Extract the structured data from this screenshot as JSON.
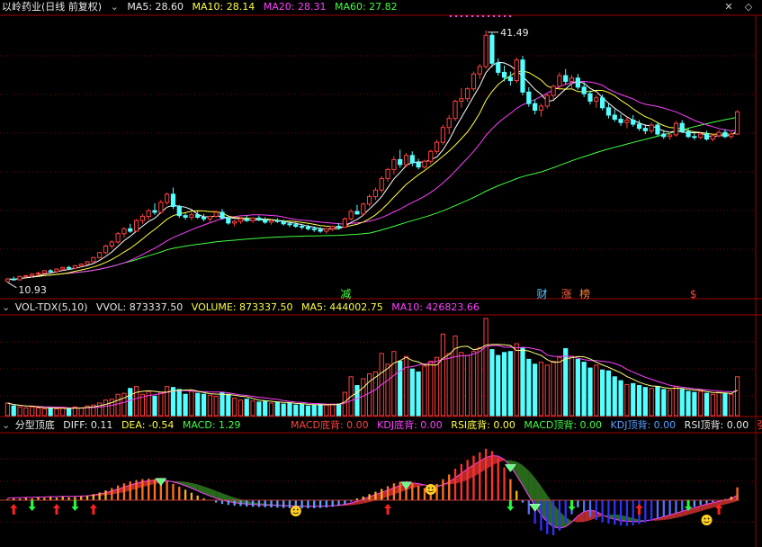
{
  "colors": {
    "bg": "#000000",
    "grid": "#7a0000",
    "up": "#ff4040",
    "down": "#54ffff",
    "ma5": "#ffffff",
    "ma10": "#ffff40",
    "ma20": "#ff40ff",
    "ma60": "#40ff40",
    "label_white": "#e8e8e8",
    "label_yellow": "#ffff40",
    "label_magenta": "#ff40ff",
    "label_green": "#40ff40",
    "label_red": "#ff4040"
  },
  "price_panel": {
    "stock_name": "以岭药业(日线 前复权)",
    "ma5_text": "MA5: 28.60",
    "ma10_text": "MA10: 28.14",
    "ma20_text": "MA20: 28.31",
    "ma60_text": "MA60: 27.82",
    "high_label": "41.49",
    "low_label": "10.93",
    "markers": [
      {
        "text": "减",
        "color": "#40ff40"
      },
      {
        "text": "财",
        "color": "#54c8ff"
      },
      {
        "text": "涨",
        "color": "#ff6040"
      },
      {
        "text": "榜",
        "color": "#ff8040"
      },
      {
        "text": "$",
        "color": "#ff4040"
      }
    ]
  },
  "volume_panel": {
    "indicator": "VOL-TDX(5,10)",
    "vvol_text": "VVOL: 873337.50",
    "volume_text": "VOLUME: 873337.50",
    "ma5_text": "MA5: 444002.75",
    "ma10_text": "MA10: 426823.66"
  },
  "macd_panel": {
    "indicator": "分型顶底",
    "diff_text": "DIFF: 0.11",
    "dea_text": "DEA: -0.54",
    "macd_text": "MACD: 1.29",
    "signals": [
      {
        "text": "MACD底背: 0.00",
        "color": "#ff4040"
      },
      {
        "text": "KDJ底背: 0.00",
        "color": "#ff40ff"
      },
      {
        "text": "RSI底背: 0.00",
        "color": "#ffff40"
      },
      {
        "text": "MACD顶背: 0.00",
        "color": "#40ff40"
      },
      {
        "text": "KDJ顶背: 0.00",
        "color": "#5aa0ff"
      },
      {
        "text": "RSI顶背: 0.00",
        "color": "#e8e8e8"
      },
      {
        "text": "强",
        "color": "#ff4040"
      }
    ]
  },
  "chart_data": {
    "type": "candlestick",
    "title": "以岭药业(日线 前复权)",
    "ylim": [
      10,
      43
    ],
    "candles": [
      [
        11.0,
        11.4,
        10.9,
        11.3
      ],
      [
        11.3,
        11.6,
        11.1,
        11.2
      ],
      [
        11.2,
        11.7,
        11.1,
        11.6
      ],
      [
        11.6,
        11.8,
        11.4,
        11.7
      ],
      [
        11.7,
        12.0,
        11.5,
        11.9
      ],
      [
        11.9,
        12.2,
        11.7,
        12.0
      ],
      [
        12.0,
        12.4,
        11.9,
        12.3
      ],
      [
        12.3,
        12.5,
        12.1,
        12.2
      ],
      [
        12.2,
        12.6,
        12.0,
        12.5
      ],
      [
        12.5,
        12.8,
        12.3,
        12.7
      ],
      [
        12.7,
        12.9,
        12.4,
        12.6
      ],
      [
        12.6,
        13.0,
        12.5,
        12.9
      ],
      [
        12.9,
        13.2,
        12.7,
        13.1
      ],
      [
        13.1,
        13.5,
        13.0,
        13.4
      ],
      [
        13.4,
        14.0,
        13.3,
        13.9
      ],
      [
        13.9,
        14.6,
        13.8,
        14.5
      ],
      [
        14.5,
        15.5,
        14.3,
        15.3
      ],
      [
        15.3,
        16.0,
        15.0,
        15.8
      ],
      [
        15.8,
        17.0,
        15.6,
        16.8
      ],
      [
        16.8,
        17.6,
        16.3,
        17.4
      ],
      [
        17.4,
        18.0,
        16.9,
        17.1
      ],
      [
        17.1,
        18.6,
        17.0,
        18.4
      ],
      [
        18.4,
        19.2,
        18.0,
        18.9
      ],
      [
        18.9,
        19.8,
        18.5,
        19.6
      ],
      [
        19.6,
        20.5,
        19.1,
        19.4
      ],
      [
        19.4,
        20.9,
        19.2,
        20.6
      ],
      [
        20.6,
        21.8,
        20.3,
        21.6
      ],
      [
        21.6,
        22.4,
        19.8,
        20.1
      ],
      [
        20.1,
        20.3,
        18.7,
        19.0
      ],
      [
        19.0,
        19.3,
        18.5,
        18.8
      ],
      [
        18.8,
        19.4,
        18.4,
        19.1
      ],
      [
        19.1,
        19.5,
        18.6,
        18.8
      ],
      [
        18.8,
        19.2,
        18.3,
        18.6
      ],
      [
        18.6,
        19.0,
        18.2,
        18.9
      ],
      [
        18.9,
        19.6,
        18.7,
        19.4
      ],
      [
        19.4,
        19.8,
        18.5,
        18.7
      ],
      [
        18.7,
        18.9,
        17.9,
        18.1
      ],
      [
        18.1,
        18.5,
        17.7,
        18.3
      ],
      [
        18.3,
        18.8,
        18.0,
        18.6
      ],
      [
        18.6,
        19.0,
        18.2,
        18.4
      ],
      [
        18.4,
        18.8,
        18.1,
        18.7
      ],
      [
        18.7,
        19.0,
        18.3,
        18.5
      ],
      [
        18.5,
        18.8,
        18.0,
        18.2
      ],
      [
        18.2,
        18.6,
        17.9,
        18.4
      ],
      [
        18.4,
        18.7,
        18.1,
        18.3
      ],
      [
        18.3,
        18.5,
        17.8,
        18.0
      ],
      [
        18.0,
        18.3,
        17.6,
        17.9
      ],
      [
        17.9,
        18.2,
        17.5,
        17.7
      ],
      [
        17.7,
        18.0,
        17.3,
        17.6
      ],
      [
        17.6,
        17.9,
        17.2,
        17.4
      ],
      [
        17.4,
        17.7,
        17.0,
        17.3
      ],
      [
        17.3,
        17.6,
        16.9,
        17.1
      ],
      [
        17.1,
        17.5,
        16.8,
        17.4
      ],
      [
        17.4,
        17.8,
        17.1,
        17.7
      ],
      [
        17.7,
        18.1,
        17.3,
        17.6
      ],
      [
        17.6,
        18.8,
        17.5,
        18.6
      ],
      [
        18.6,
        19.8,
        18.4,
        19.5
      ],
      [
        19.5,
        20.3,
        19.1,
        19.2
      ],
      [
        19.2,
        20.6,
        19.0,
        20.4
      ],
      [
        20.4,
        21.6,
        20.1,
        21.3
      ],
      [
        21.3,
        22.4,
        20.9,
        22.1
      ],
      [
        22.1,
        23.8,
        21.8,
        23.5
      ],
      [
        23.5,
        24.8,
        23.1,
        24.6
      ],
      [
        24.6,
        26.2,
        24.0,
        25.8
      ],
      [
        25.8,
        27.0,
        24.8,
        25.2
      ],
      [
        25.2,
        26.6,
        24.9,
        26.3
      ],
      [
        26.3,
        26.8,
        25.0,
        25.4
      ],
      [
        25.4,
        25.9,
        24.6,
        24.9
      ],
      [
        24.9,
        25.8,
        24.7,
        25.6
      ],
      [
        25.6,
        27.0,
        25.3,
        26.8
      ],
      [
        26.8,
        28.2,
        26.5,
        27.9
      ],
      [
        27.9,
        30.0,
        27.6,
        29.7
      ],
      [
        29.7,
        31.2,
        28.9,
        30.8
      ],
      [
        30.8,
        33.1,
        30.5,
        32.9
      ],
      [
        32.9,
        34.5,
        32.1,
        33.2
      ],
      [
        33.2,
        34.6,
        32.8,
        34.4
      ],
      [
        34.4,
        36.5,
        34.1,
        36.2
      ],
      [
        36.2,
        37.4,
        35.6,
        37.1
      ],
      [
        37.1,
        41.49,
        36.8,
        40.9
      ],
      [
        40.9,
        41.2,
        37.0,
        37.5
      ],
      [
        37.5,
        38.1,
        36.0,
        36.4
      ],
      [
        36.4,
        37.2,
        35.3,
        35.8
      ],
      [
        35.8,
        36.5,
        34.8,
        35.4
      ],
      [
        35.4,
        38.2,
        35.1,
        37.9
      ],
      [
        37.9,
        38.4,
        33.6,
        34.0
      ],
      [
        34.0,
        34.6,
        32.2,
        32.6
      ],
      [
        32.6,
        33.1,
        31.3,
        31.8
      ],
      [
        31.8,
        32.6,
        31.0,
        32.3
      ],
      [
        32.3,
        33.8,
        32.0,
        33.6
      ],
      [
        33.6,
        34.9,
        33.1,
        34.7
      ],
      [
        34.7,
        36.4,
        34.2,
        36.0
      ],
      [
        36.0,
        36.8,
        34.9,
        35.3
      ],
      [
        35.3,
        36.1,
        34.5,
        35.7
      ],
      [
        35.7,
        36.2,
        34.3,
        34.6
      ],
      [
        34.6,
        35.2,
        33.4,
        33.8
      ],
      [
        33.8,
        34.2,
        32.5,
        32.9
      ],
      [
        32.9,
        33.6,
        32.1,
        33.3
      ],
      [
        33.3,
        33.7,
        31.8,
        32.1
      ],
      [
        32.1,
        32.6,
        30.8,
        31.2
      ],
      [
        31.2,
        31.9,
        30.4,
        30.7
      ],
      [
        30.7,
        31.3,
        29.9,
        30.3
      ],
      [
        30.3,
        30.9,
        29.6,
        30.6
      ],
      [
        30.6,
        31.2,
        29.8,
        30.1
      ],
      [
        30.1,
        30.6,
        29.3,
        29.6
      ],
      [
        29.6,
        30.1,
        28.9,
        29.3
      ],
      [
        29.3,
        30.3,
        29.0,
        30.0
      ],
      [
        30.0,
        30.4,
        28.7,
        28.9
      ],
      [
        28.9,
        29.4,
        28.3,
        28.6
      ],
      [
        28.6,
        29.2,
        28.2,
        28.8
      ],
      [
        28.8,
        30.5,
        28.6,
        30.2
      ],
      [
        30.2,
        30.6,
        29.0,
        29.2
      ],
      [
        29.2,
        29.6,
        28.4,
        28.6
      ],
      [
        28.6,
        29.0,
        28.2,
        28.5
      ],
      [
        28.5,
        29.1,
        28.3,
        28.9
      ],
      [
        28.9,
        29.3,
        28.1,
        28.3
      ],
      [
        28.3,
        28.9,
        28.0,
        28.7
      ],
      [
        28.7,
        29.4,
        28.5,
        29.1
      ],
      [
        29.1,
        29.5,
        28.4,
        28.6
      ],
      [
        28.6,
        29.2,
        28.3,
        28.9
      ],
      [
        28.9,
        31.8,
        28.8,
        31.6
      ]
    ],
    "volumes": [
      0.13,
      0.1,
      0.09,
      0.08,
      0.09,
      0.08,
      0.07,
      0.08,
      0.07,
      0.08,
      0.07,
      0.09,
      0.08,
      0.1,
      0.11,
      0.13,
      0.16,
      0.17,
      0.22,
      0.23,
      0.28,
      0.3,
      0.22,
      0.25,
      0.2,
      0.24,
      0.3,
      0.29,
      0.27,
      0.22,
      0.25,
      0.23,
      0.22,
      0.21,
      0.2,
      0.24,
      0.22,
      0.18,
      0.16,
      0.17,
      0.15,
      0.14,
      0.15,
      0.13,
      0.14,
      0.12,
      0.13,
      0.11,
      0.12,
      0.1,
      0.11,
      0.12,
      0.11,
      0.12,
      0.12,
      0.24,
      0.4,
      0.31,
      0.38,
      0.43,
      0.45,
      0.64,
      0.53,
      0.66,
      0.56,
      0.61,
      0.48,
      0.45,
      0.51,
      0.56,
      0.6,
      0.84,
      0.64,
      0.82,
      0.65,
      0.62,
      0.66,
      0.7,
      1.0,
      0.68,
      0.62,
      0.65,
      0.66,
      0.74,
      0.7,
      0.58,
      0.53,
      0.55,
      0.52,
      0.56,
      0.6,
      0.69,
      0.61,
      0.58,
      0.55,
      0.49,
      0.52,
      0.47,
      0.46,
      0.4,
      0.36,
      0.32,
      0.33,
      0.31,
      0.29,
      0.28,
      0.3,
      0.27,
      0.26,
      0.3,
      0.27,
      0.25,
      0.24,
      0.25,
      0.23,
      0.22,
      0.24,
      0.23,
      0.22,
      0.4
    ],
    "macd": [
      0.05,
      0.08,
      0.07,
      0.1,
      0.08,
      0.12,
      0.1,
      0.14,
      0.11,
      0.15,
      0.12,
      0.14,
      0.16,
      0.2,
      0.26,
      0.33,
      0.42,
      0.52,
      0.63,
      0.72,
      0.8,
      0.86,
      0.9,
      0.92,
      0.9,
      0.86,
      0.8,
      0.7,
      0.58,
      0.45,
      0.32,
      0.2,
      0.08,
      -0.02,
      -0.1,
      -0.16,
      -0.2,
      -0.23,
      -0.25,
      -0.27,
      -0.28,
      -0.29,
      -0.3,
      -0.31,
      -0.32,
      -0.33,
      -0.34,
      -0.34,
      -0.35,
      -0.35,
      -0.34,
      -0.33,
      -0.31,
      -0.28,
      -0.24,
      -0.18,
      -0.06,
      0.08,
      0.16,
      0.26,
      0.36,
      0.48,
      0.6,
      0.72,
      0.78,
      0.8,
      0.74,
      0.62,
      0.52,
      0.56,
      0.7,
      0.9,
      1.1,
      1.35,
      1.55,
      1.72,
      1.9,
      2.05,
      2.2,
      2.1,
      1.8,
      1.4,
      0.9,
      0.4,
      -0.1,
      -0.6,
      -1.0,
      -1.3,
      -1.45,
      -1.5,
      -1.3,
      -1.0,
      -0.6,
      -0.3,
      -0.5,
      -0.7,
      -0.85,
      -0.95,
      -1.0,
      -1.05,
      -1.08,
      -1.1,
      -1.08,
      -1.02,
      -0.95,
      -0.88,
      -0.8,
      -0.7,
      -0.62,
      -0.55,
      -0.45,
      -0.36,
      -0.28,
      -0.2,
      -0.14,
      -0.08,
      -0.02,
      0.05,
      0.15,
      0.55
    ]
  }
}
